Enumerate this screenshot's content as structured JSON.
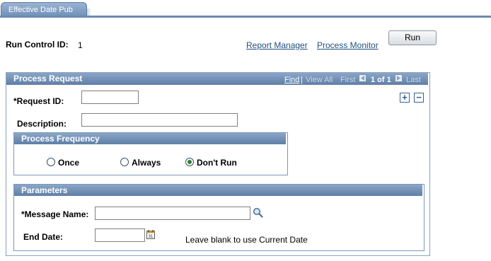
{
  "tab": {
    "label": "Effective Date Pub"
  },
  "run_control": {
    "label": "Run Control ID:",
    "value": "1"
  },
  "links": {
    "report_manager": "Report Manager",
    "process_monitor": "Process Monitor"
  },
  "run_button": "Run",
  "process_request": {
    "title": "Process Request",
    "nav": {
      "find": "Find",
      "separator": "|",
      "view_all": "View All",
      "first": "First",
      "count": "1 of 1",
      "last": "Last"
    },
    "request_id": {
      "label": "*Request ID:",
      "value": ""
    },
    "description": {
      "label": "Description:",
      "value": ""
    }
  },
  "process_frequency": {
    "title": "Process Frequency",
    "options": [
      "Once",
      "Always",
      "Don't Run"
    ],
    "selected": "Don't Run"
  },
  "parameters": {
    "title": "Parameters",
    "message_name": {
      "label": "*Message Name:",
      "value": ""
    },
    "end_date": {
      "label": "End Date:",
      "value": "",
      "hint": "Leave blank to use Current Date"
    }
  },
  "icons": {
    "add": "plus-icon",
    "remove": "minus-icon",
    "lookup": "magnifier-icon",
    "calendar": "calendar-icon",
    "prev": "triangle-left-icon",
    "next": "triangle-right-icon"
  },
  "colors": {
    "group_header": "#6f8fb8",
    "link": "#1f4f82",
    "radio_selected": "#2e7d32"
  }
}
